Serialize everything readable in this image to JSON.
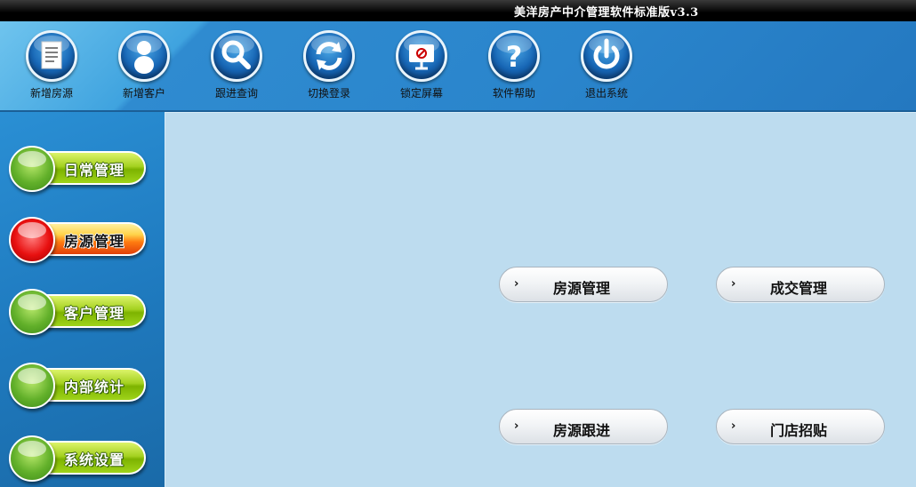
{
  "window": {
    "title": "美洋房产中介管理软件标准版v3.3"
  },
  "toolbar": {
    "items": [
      {
        "label": "新增房源",
        "icon": "document-icon"
      },
      {
        "label": "新增客户",
        "icon": "user-icon"
      },
      {
        "label": "跟进查询",
        "icon": "search-icon"
      },
      {
        "label": "切换登录",
        "icon": "refresh-icon"
      },
      {
        "label": "锁定屏幕",
        "icon": "monitor-lock-icon"
      },
      {
        "label": "软件帮助",
        "icon": "help-icon"
      },
      {
        "label": "退出系统",
        "icon": "power-icon"
      }
    ]
  },
  "sidebar": {
    "items": [
      {
        "label": "日常管理",
        "state": "normal",
        "color": "#9fd41a"
      },
      {
        "label": "房源管理",
        "state": "active",
        "color": "#e81010"
      },
      {
        "label": "客户管理",
        "state": "normal",
        "color": "#9fd41a"
      },
      {
        "label": "内部统计",
        "state": "normal",
        "color": "#9fd41a"
      },
      {
        "label": "系统设置",
        "state": "normal",
        "color": "#9fd41a"
      }
    ]
  },
  "main": {
    "buttons": [
      {
        "label": "房源管理",
        "arrow": "›"
      },
      {
        "label": "成交管理",
        "arrow": "›"
      },
      {
        "label": "房源跟进",
        "arrow": "›"
      },
      {
        "label": "门店招贴",
        "arrow": "›"
      }
    ]
  },
  "colors": {
    "toolbar_bg": "#2a85cc",
    "panel_bg": "#bddcef",
    "nav_green": "#9fd41a",
    "nav_active_red": "#e81010"
  }
}
